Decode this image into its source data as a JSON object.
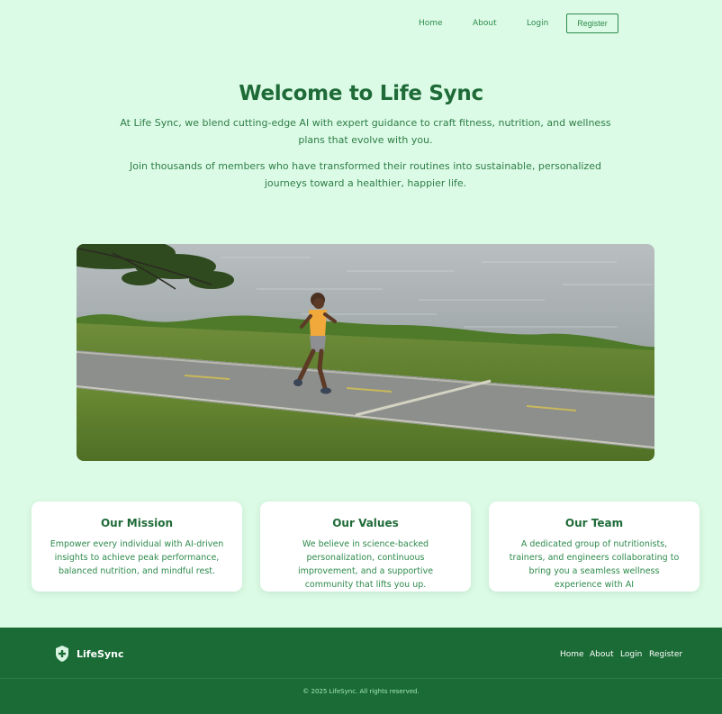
{
  "nav": {
    "home": "Home",
    "about": "About",
    "login": "Login",
    "register": "Register"
  },
  "hero": {
    "title": "Welcome to Life Sync",
    "paragraph1": "At Life Sync, we blend cutting-edge AI with expert guidance to craft fitness, nutrition, and wellness plans that evolve with you.",
    "paragraph2": "Join thousands of members who have transformed their routines into sustainable, personalized journeys toward a healthier, happier life."
  },
  "cards": [
    {
      "title": "Our Mission",
      "text": "Empower every individual with AI-driven insights to achieve peak performance, balanced nutrition, and mindful rest."
    },
    {
      "title": "Our Values",
      "text": "We believe in science-backed personalization, continuous improvement, and a supportive community that lifts you up."
    },
    {
      "title": "Our Team",
      "text": "A dedicated group of nutritionists, trainers, and engineers collaborating to bring you a seamless wellness experience with AI"
    }
  ],
  "footer": {
    "brand": "LifeSync",
    "links": [
      "Home",
      "About",
      "Login",
      "Register"
    ],
    "copyright": "© 2025 LifeSync. All rights reserved.",
    "logo_icon": "shield-plus-icon"
  },
  "colors": {
    "background": "#dcfbe6",
    "primary": "#1f6b38",
    "accent": "#2d8a4c",
    "footer": "#1a6b35"
  }
}
